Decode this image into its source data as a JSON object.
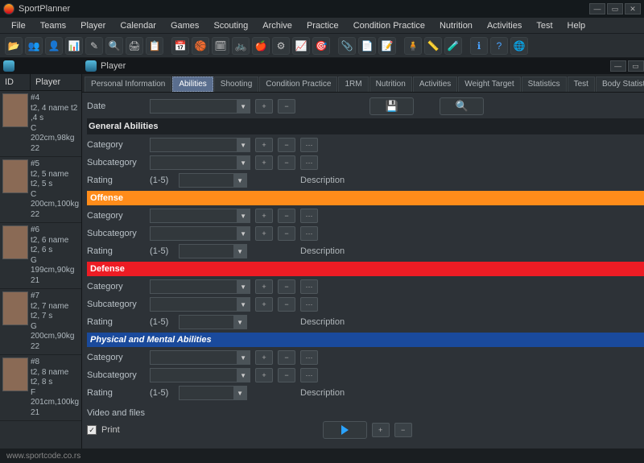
{
  "app": {
    "title": "SportPlanner"
  },
  "menu": [
    "File",
    "Teams",
    "Player",
    "Calendar",
    "Games",
    "Scouting",
    "Archive",
    "Practice",
    "Condition Practice",
    "Nutrition",
    "Activities",
    "Test",
    "Help"
  ],
  "left": {
    "cols": {
      "id": "ID",
      "player": "Player"
    },
    "rows": [
      {
        "id": "#4",
        "l1": "t2, 4 name t2 ,4 s",
        "l2": "C",
        "l3": "202cm,98kg",
        "l4": "22"
      },
      {
        "id": "#5",
        "l1": "t2, 5 name t2, 5 s",
        "l2": "C",
        "l3": "200cm,100kg",
        "l4": "22"
      },
      {
        "id": "#6",
        "l1": "t2, 6 name t2, 6 s",
        "l2": "G",
        "l3": "199cm,90kg",
        "l4": "21"
      },
      {
        "id": "#7",
        "l1": "t2, 7 name t2, 7 s",
        "l2": "G",
        "l3": "200cm,90kg",
        "l4": "22"
      },
      {
        "id": "#8",
        "l1": "t2, 8 name t2, 8 s",
        "l2": "F",
        "l3": "201cm,100kg",
        "l4": "21"
      }
    ]
  },
  "right": {
    "title": "Player",
    "tabs": [
      "Personal Information",
      "Abilities",
      "Shooting",
      "Condition Practice",
      "1RM",
      "Nutrition",
      "Activities",
      "Weight Target",
      "Statistics",
      "Test",
      "Body Statistics"
    ],
    "active_tab": "Abilities",
    "labels": {
      "date": "Date",
      "general": "General Abilities",
      "offense": "Offense",
      "defense": "Defense",
      "physmental": "Physical and Mental Abilities",
      "category": "Category",
      "subcategory": "Subcategory",
      "rating": "Rating",
      "ratingRange": "(1-5)",
      "description": "Description",
      "video": "Video and files",
      "print": "Print"
    }
  },
  "footer": {
    "link": "www.sportcode.co.rs"
  }
}
